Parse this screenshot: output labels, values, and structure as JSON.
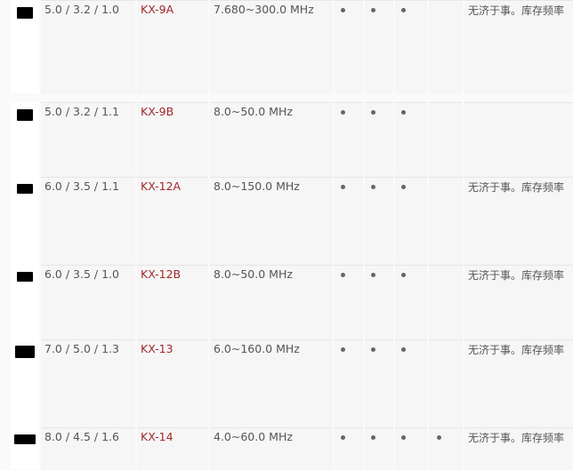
{
  "rows": [
    {
      "dims": "5.0 / 3.2 / 1.0",
      "part": "KX-9A",
      "freq": "7.680~300.0 MHz",
      "dots": [
        true,
        true,
        true,
        false
      ],
      "note": "无济于事。库存频率"
    },
    {
      "dims": "5.0 / 3.2 / 1.1",
      "part": "KX-9B",
      "freq": "8.0~50.0 MHz",
      "dots": [
        true,
        true,
        true,
        false
      ],
      "note": ""
    },
    {
      "dims": "6.0 / 3.5 / 1.1",
      "part": "KX-12A",
      "freq": "8.0~150.0 MHz",
      "dots": [
        true,
        true,
        true,
        false
      ],
      "note": "无济于事。库存频率"
    },
    {
      "dims": "6.0 / 3.5 / 1.0",
      "part": "KX-12B",
      "freq": "8.0~50.0 MHz",
      "dots": [
        true,
        true,
        true,
        false
      ],
      "note": "无济于事。库存频率"
    },
    {
      "dims": "7.0 / 5.0 / 1.3",
      "part": "KX-13",
      "freq": "6.0~160.0 MHz",
      "dots": [
        true,
        true,
        true,
        false
      ],
      "note": "无济于事。库存频率"
    },
    {
      "dims": "8.0 / 4.5 / 1.6",
      "part": "KX-14",
      "freq": "4.0~60.0 MHz",
      "dots": [
        true,
        true,
        true,
        true
      ],
      "note": "无济于事。库存频率"
    }
  ]
}
